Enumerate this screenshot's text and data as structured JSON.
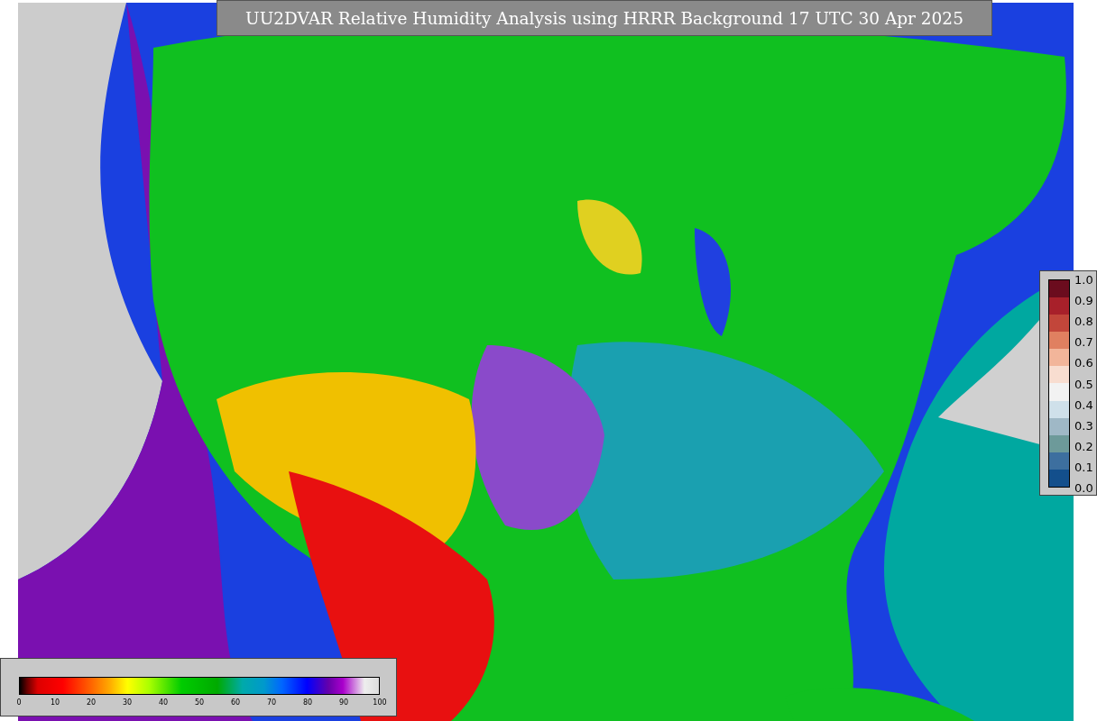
{
  "title": "UU2DVAR Relative Humidity Analysis using HRRR Background 17 UTC 30 Apr 2025",
  "humidity_scale": {
    "ticks": [
      "0",
      "10",
      "20",
      "30",
      "40",
      "50",
      "60",
      "70",
      "80",
      "90",
      "100"
    ]
  },
  "ratio_scale": {
    "ticks": [
      "1.0",
      "0.9",
      "0.8",
      "0.7",
      "0.6",
      "0.5",
      "0.4",
      "0.3",
      "0.2",
      "0.1",
      "0.0"
    ]
  }
}
